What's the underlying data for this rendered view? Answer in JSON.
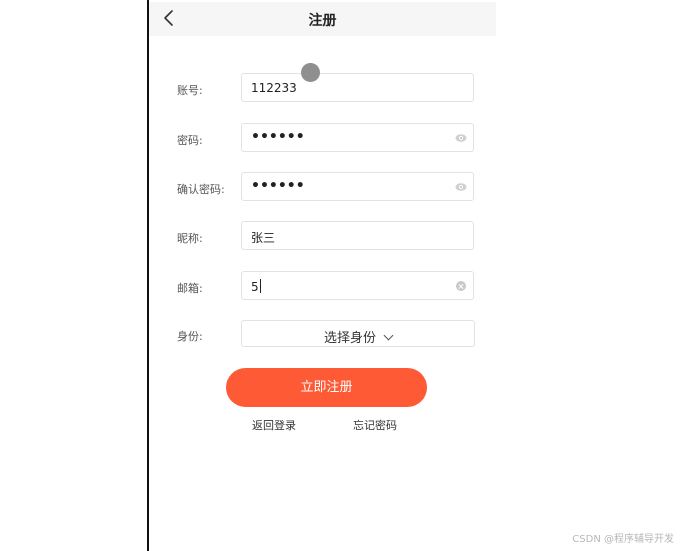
{
  "header": {
    "title": "注册",
    "back_icon": "chevron-left-icon"
  },
  "form": {
    "account": {
      "label": "账号:",
      "value": "112233"
    },
    "password": {
      "label": "密码:",
      "value": "••••••",
      "icon": "eye-icon"
    },
    "confirm_password": {
      "label": "确认密码:",
      "value": "••••••",
      "icon": "eye-icon"
    },
    "nickname": {
      "label": "昵称:",
      "value": "张三"
    },
    "email": {
      "label": "邮箱:",
      "value": "5",
      "icon": "clear-icon"
    },
    "identity": {
      "label": "身份:",
      "select_text": "选择身份",
      "icon": "chevron-down-icon"
    }
  },
  "actions": {
    "register_label": "立即注册",
    "back_to_login_label": "返回登录",
    "forgot_password_label": "忘记密码"
  },
  "colors": {
    "accent": "#ff5a36",
    "navbar_bg": "#f6f6f6",
    "border": "#e2e2e2"
  },
  "watermark": "CSDN @程序辅导开发"
}
